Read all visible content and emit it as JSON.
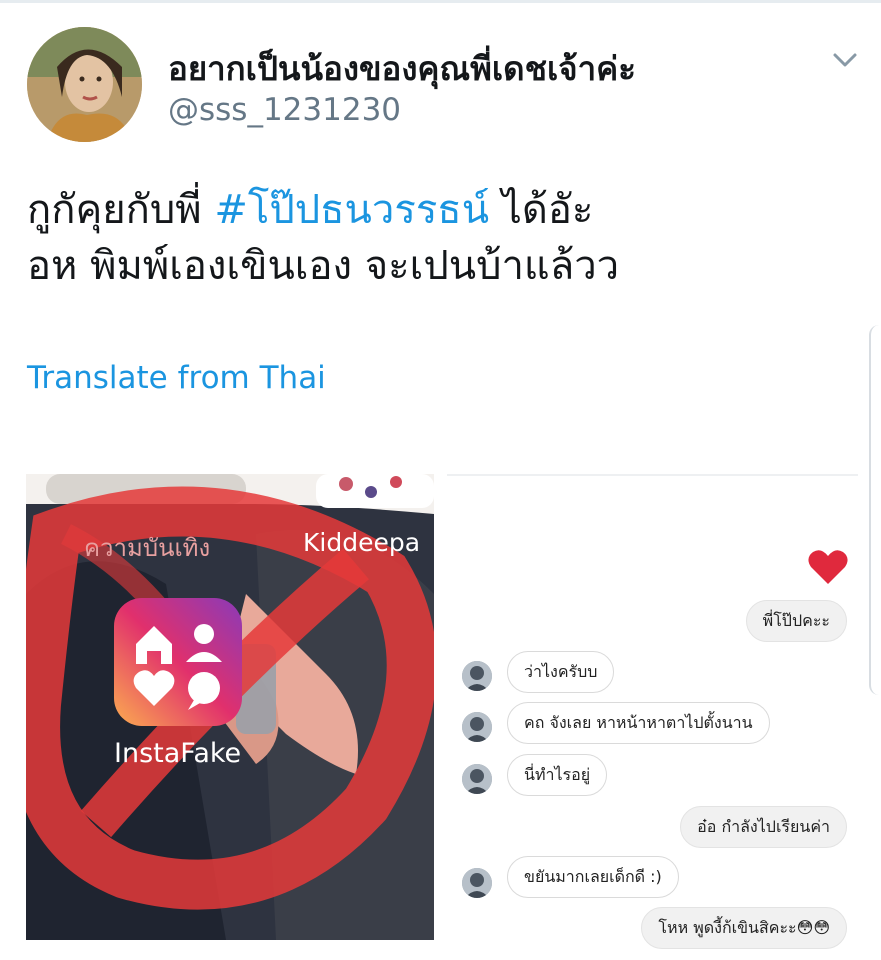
{
  "tweet": {
    "display_name": "อยากเป็นน้องของคุณพี่เดชเจ้าค่ะ",
    "handle": "@sss_1231230",
    "text_line1_before": "กูกัคุยกับพี่ ",
    "hashtag": "#โป๊ปธนวรรธน์",
    "text_line1_after": " ได้อัะ",
    "text_line2": "อห พิมพ์เองเขินเอง จะเปนบ้าแล้วว",
    "translate_label": "Translate from Thai"
  },
  "media_left": {
    "category_label": "ความบันเทิง",
    "partial_app_label": "Kiddeepa",
    "app_label": "InstaFake",
    "app_icon_gradient": [
      "#8a3ab9",
      "#e1306c",
      "#fbad50"
    ]
  },
  "chat": {
    "messages": [
      {
        "side": "out",
        "text": "พี่โป๊ปคะะ"
      },
      {
        "side": "in",
        "text": "ว่าไงครับบ"
      },
      {
        "side": "in",
        "text": "คถ จังเลย หาหน้าหาตาไปตั้งนาน"
      },
      {
        "side": "in",
        "text": "นี่ทำไรอยู่"
      },
      {
        "side": "out",
        "text": "อ๋อ กำลังไปเรียนค่า"
      },
      {
        "side": "in",
        "text": "ขยันมากเลยเด็กดี :)"
      },
      {
        "side": "out",
        "text": "โหห พูดงี้ก้เขินสิคะะ😳😳"
      }
    ],
    "heart_color": "#e0293d"
  },
  "colors": {
    "link": "#1b95e0",
    "text": "#14171a",
    "muted": "#657786"
  }
}
